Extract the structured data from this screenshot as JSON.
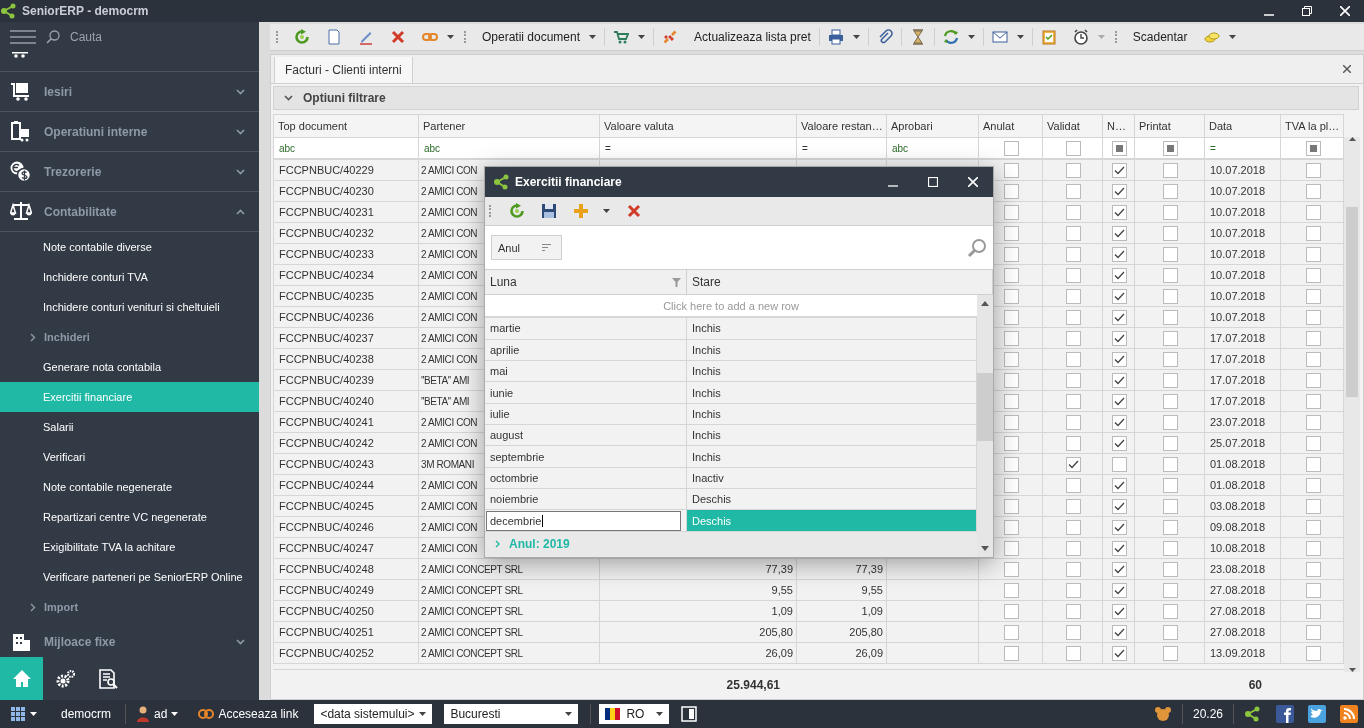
{
  "window": {
    "title": "SeniorERP - democrm"
  },
  "sidebar": {
    "search": {
      "placeholder": "Cauta"
    },
    "sections": [
      {
        "label": "Iesiri",
        "expanded": false
      },
      {
        "label": "Operatiuni interne",
        "expanded": false
      },
      {
        "label": "Trezorerie",
        "expanded": false
      },
      {
        "label": "Contabilitate",
        "expanded": true,
        "items": [
          {
            "kind": "link",
            "label": "Note contabile diverse",
            "selected": false
          },
          {
            "kind": "link",
            "label": "Inchidere conturi TVA",
            "selected": false
          },
          {
            "kind": "link",
            "label": "Inchidere conturi venituri si cheltuieli",
            "selected": false
          },
          {
            "kind": "group",
            "label": "Inchideri",
            "selected": false,
            "expanded": false
          },
          {
            "kind": "link",
            "label": "Generare nota contabila",
            "selected": false
          },
          {
            "kind": "link",
            "label": "Exercitii financiare",
            "selected": true
          },
          {
            "kind": "link",
            "label": "Salarii",
            "selected": false
          },
          {
            "kind": "link",
            "label": "Verificari",
            "selected": false
          },
          {
            "kind": "link",
            "label": "Note contabile negenerate",
            "selected": false
          },
          {
            "kind": "link",
            "label": "Repartizari centre VC negenerate",
            "selected": false
          },
          {
            "kind": "link",
            "label": "Exigibilitate TVA la achitare",
            "selected": false
          },
          {
            "kind": "link",
            "label": "Verificare parteneri pe SeniorERP Online",
            "selected": false
          },
          {
            "kind": "group",
            "label": "Import",
            "selected": false,
            "expanded": false
          }
        ]
      },
      {
        "label": "Mijloace fixe",
        "expanded": false
      }
    ],
    "bottom_buttons": [
      {
        "selected": true
      },
      {
        "selected": false
      },
      {
        "selected": false
      }
    ]
  },
  "toolbar": {
    "buttons": [
      {
        "label": "Operatii document",
        "dropdown": true
      },
      {
        "label": "Actualizeaza lista pret",
        "dropdown": false
      },
      {
        "label": "Scadentar",
        "dropdown": false
      }
    ]
  },
  "tabs": [
    {
      "label": "Facturi - Clienti interni",
      "selected": true
    }
  ],
  "filter_panel": {
    "label": "Optiuni filtrare",
    "expanded": false
  },
  "table": {
    "columns": [
      {
        "label": "Top document",
        "kind": "text",
        "filter": "abc"
      },
      {
        "label": "Partener",
        "kind": "text",
        "filter": "abc"
      },
      {
        "label": "Valoare valuta",
        "kind": "number",
        "filter": "="
      },
      {
        "label": "Valoare restan…",
        "kind": "number",
        "filter": "="
      },
      {
        "label": "Aprobari",
        "kind": "text",
        "filter": "abc"
      },
      {
        "label": "Anulat",
        "kind": "check",
        "filter_indeterminate": false
      },
      {
        "label": "Validat",
        "kind": "check",
        "filter_indeterminate": false
      },
      {
        "label": "N…",
        "kind": "check",
        "filter_indeterminate": true
      },
      {
        "label": "Printat",
        "kind": "check",
        "filter_indeterminate": true
      },
      {
        "label": "Data",
        "kind": "text",
        "filter": "="
      },
      {
        "label": "TVA la pl…",
        "kind": "check",
        "filter_indeterminate": true
      }
    ],
    "rows": [
      {
        "top_document": "FCCPNBUC/40229",
        "partener": "2 AMICI CON",
        "anulat": false,
        "validat": false,
        "n": true,
        "printat": false,
        "data": "10.07.2018",
        "tva": false
      },
      {
        "top_document": "FCCPNBUC/40230",
        "partener": "2 AMICI CON",
        "anulat": false,
        "validat": false,
        "n": true,
        "printat": false,
        "data": "10.07.2018",
        "tva": false
      },
      {
        "top_document": "FCCPNBUC/40231",
        "partener": "2 AMICI CON",
        "anulat": false,
        "validat": false,
        "n": true,
        "printat": false,
        "data": "10.07.2018",
        "tva": false
      },
      {
        "top_document": "FCCPNBUC/40232",
        "partener": "2 AMICI CON",
        "anulat": false,
        "validat": false,
        "n": true,
        "printat": false,
        "data": "10.07.2018",
        "tva": false
      },
      {
        "top_document": "FCCPNBUC/40233",
        "partener": "2 AMICI CON",
        "anulat": false,
        "validat": false,
        "n": true,
        "printat": false,
        "data": "10.07.2018",
        "tva": false
      },
      {
        "top_document": "FCCPNBUC/40234",
        "partener": "2 AMICI CON",
        "anulat": false,
        "validat": false,
        "n": true,
        "printat": false,
        "data": "10.07.2018",
        "tva": false
      },
      {
        "top_document": "FCCPNBUC/40235",
        "partener": "2 AMICI CON",
        "anulat": false,
        "validat": false,
        "n": true,
        "printat": false,
        "data": "10.07.2018",
        "tva": false
      },
      {
        "top_document": "FCCPNBUC/40236",
        "partener": "2 AMICI CON",
        "anulat": false,
        "validat": false,
        "n": true,
        "printat": false,
        "data": "10.07.2018",
        "tva": false
      },
      {
        "top_document": "FCCPNBUC/40237",
        "partener": "2 AMICI CON",
        "anulat": false,
        "validat": false,
        "n": true,
        "printat": false,
        "data": "17.07.2018",
        "tva": false
      },
      {
        "top_document": "FCCPNBUC/40238",
        "partener": "2 AMICI CON",
        "anulat": false,
        "validat": false,
        "n": true,
        "printat": false,
        "data": "17.07.2018",
        "tva": false
      },
      {
        "top_document": "FCCPNBUC/40239",
        "partener": "''BETA'' AMI",
        "anulat": false,
        "validat": false,
        "n": true,
        "printat": false,
        "data": "17.07.2018",
        "tva": false
      },
      {
        "top_document": "FCCPNBUC/40240",
        "partener": "''BETA'' AMI",
        "anulat": false,
        "validat": false,
        "n": true,
        "printat": false,
        "data": "17.07.2018",
        "tva": false
      },
      {
        "top_document": "FCCPNBUC/40241",
        "partener": "2 AMICI CON",
        "anulat": false,
        "validat": false,
        "n": true,
        "printat": false,
        "data": "23.07.2018",
        "tva": false
      },
      {
        "top_document": "FCCPNBUC/40242",
        "partener": "2 AMICI CON",
        "anulat": false,
        "validat": false,
        "n": true,
        "printat": false,
        "data": "25.07.2018",
        "tva": false
      },
      {
        "top_document": "FCCPNBUC/40243",
        "partener": "3M ROMANI",
        "anulat": false,
        "validat": true,
        "n": false,
        "printat": false,
        "data": "01.08.2018",
        "tva": false
      },
      {
        "top_document": "FCCPNBUC/40244",
        "partener": "2 AMICI CON",
        "anulat": false,
        "validat": false,
        "n": true,
        "printat": false,
        "data": "01.08.2018",
        "tva": false
      },
      {
        "top_document": "FCCPNBUC/40245",
        "partener": "2 AMICI CON",
        "anulat": false,
        "validat": false,
        "n": true,
        "printat": false,
        "data": "03.08.2018",
        "tva": false
      },
      {
        "top_document": "FCCPNBUC/40246",
        "partener": "2 AMICI CON",
        "anulat": false,
        "validat": false,
        "n": true,
        "printat": false,
        "data": "09.08.2018",
        "tva": false
      },
      {
        "top_document": "FCCPNBUC/40247",
        "partener": "2 AMICI CON",
        "anulat": false,
        "validat": false,
        "n": true,
        "printat": false,
        "data": "10.08.2018",
        "tva": false
      },
      {
        "top_document": "FCCPNBUC/40248",
        "partener": "2 AMICI CONCEPT SRL",
        "valoare_valuta": "77,39",
        "valoare_restanta": "77,39",
        "anulat": false,
        "validat": false,
        "n": true,
        "printat": false,
        "data": "23.08.2018",
        "tva": false
      },
      {
        "top_document": "FCCPNBUC/40249",
        "partener": "2 AMICI CONCEPT SRL",
        "valoare_valuta": "9,55",
        "valoare_restanta": "9,55",
        "anulat": false,
        "validat": false,
        "n": true,
        "printat": false,
        "data": "27.08.2018",
        "tva": false
      },
      {
        "top_document": "FCCPNBUC/40250",
        "partener": "2 AMICI CONCEPT SRL",
        "valoare_valuta": "1,09",
        "valoare_restanta": "1,09",
        "anulat": false,
        "validat": false,
        "n": true,
        "printat": false,
        "data": "27.08.2018",
        "tva": false
      },
      {
        "top_document": "FCCPNBUC/40251",
        "partener": "2 AMICI CONCEPT SRL",
        "valoare_valuta": "205,80",
        "valoare_restanta": "205,80",
        "anulat": false,
        "validat": false,
        "n": true,
        "printat": false,
        "data": "27.08.2018",
        "tva": false
      },
      {
        "top_document": "FCCPNBUC/40252",
        "partener": "2 AMICI CONCEPT SRL",
        "valoare_valuta": "26,09",
        "valoare_restanta": "26,09",
        "anulat": false,
        "validat": false,
        "n": true,
        "printat": false,
        "data": "13.09.2018",
        "tva": false
      }
    ],
    "totals": {
      "valoare_valuta": "25.944,61",
      "data": "60"
    }
  },
  "dialog": {
    "title": "Exercitii financiare",
    "group_by": "Anul",
    "columns": [
      {
        "label": "Luna",
        "filter": true
      },
      {
        "label": "Stare",
        "filter": false
      }
    ],
    "new_row_hint": "Click here to add a new row",
    "rows": [
      {
        "luna": "martie",
        "stare": "Inchis",
        "selected": false,
        "editing": false
      },
      {
        "luna": "aprilie",
        "stare": "Inchis",
        "selected": false,
        "editing": false
      },
      {
        "luna": "mai",
        "stare": "Inchis",
        "selected": false,
        "editing": false
      },
      {
        "luna": "iunie",
        "stare": "Inchis",
        "selected": false,
        "editing": false
      },
      {
        "luna": "iulie",
        "stare": "Inchis",
        "selected": false,
        "editing": false
      },
      {
        "luna": "august",
        "stare": "Inchis",
        "selected": false,
        "editing": false
      },
      {
        "luna": "septembrie",
        "stare": "Inchis",
        "selected": false,
        "editing": false
      },
      {
        "luna": "octombrie",
        "stare": "Inactiv",
        "selected": false,
        "editing": false
      },
      {
        "luna": "noiembrie",
        "stare": "Deschis",
        "selected": false,
        "editing": false
      },
      {
        "luna": "decembrie",
        "stare": "Deschis",
        "selected": true,
        "editing": true
      }
    ],
    "groups": [
      {
        "label": "Anul: 2019",
        "expanded": false
      }
    ]
  },
  "status_bar": {
    "database": "democrm",
    "user": "ad",
    "link": "Acceseaza link",
    "date_combo": "<data sistemului>",
    "city_combo": "Bucuresti",
    "language_combo": "RO",
    "time": "20.26"
  }
}
